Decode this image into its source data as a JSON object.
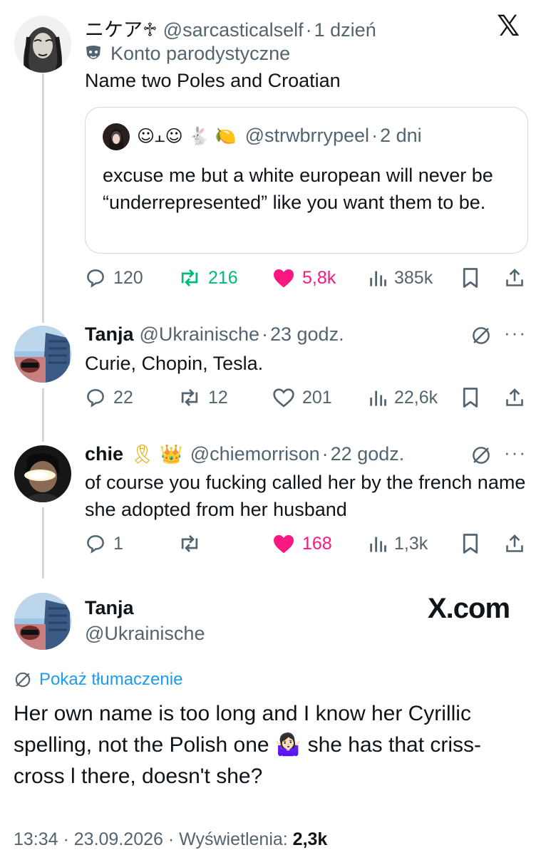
{
  "tweets": [
    {
      "display_name": "ニケア♱",
      "handle": "@sarcasticalself",
      "time": "1 dzień",
      "label": "Konto parodystyczne",
      "text": "Name two Poles and Croatian",
      "quote": {
        "display_name": "☺⫠☺ 🐇 🍋",
        "handle": "@strwbrrypeel",
        "time": "2 dni",
        "text": "excuse me but a white european will never be “underrepresented” like you want them to be."
      },
      "stats": {
        "replies": "120",
        "reposts": "216",
        "likes": "5,8k",
        "views": "385k"
      },
      "liked": true,
      "reposted": true
    },
    {
      "display_name": "Tanja",
      "handle": "@Ukrainische",
      "time": "23 godz.",
      "text": "Curie, Chopin, Tesla.",
      "stats": {
        "replies": "22",
        "reposts": "12",
        "likes": "201",
        "views": "22,6k"
      }
    },
    {
      "display_name": "chie",
      "badges": "🎗 👑",
      "handle": "@chiemorrison",
      "time": "22 godz.",
      "text": "of course you fucking called her by the french name she adopted from her husband",
      "stats": {
        "replies": "1",
        "reposts": "",
        "likes": "168",
        "views": "1,3k"
      },
      "liked": true
    }
  ],
  "main": {
    "display_name": "Tanja",
    "handle": "@Ukrainische",
    "watermark": "X.com",
    "translate": "Pokaż tłumaczenie",
    "text": "Her own name is too long and I know her Cyrillic spelling, not the Polish one 🤷🏻‍♀️ she has that criss-cross l there, doesn't she?",
    "timestamp": "13:34 · 23.09.2026 · Wyświetlenia: ",
    "views": "2,3k"
  },
  "sep": "·",
  "more": "···",
  "x_logo": "𝕏",
  "colors": {
    "like": "#f91880",
    "repost": "#00ba7c",
    "muted": "#536471",
    "link": "#1d9bf0"
  }
}
